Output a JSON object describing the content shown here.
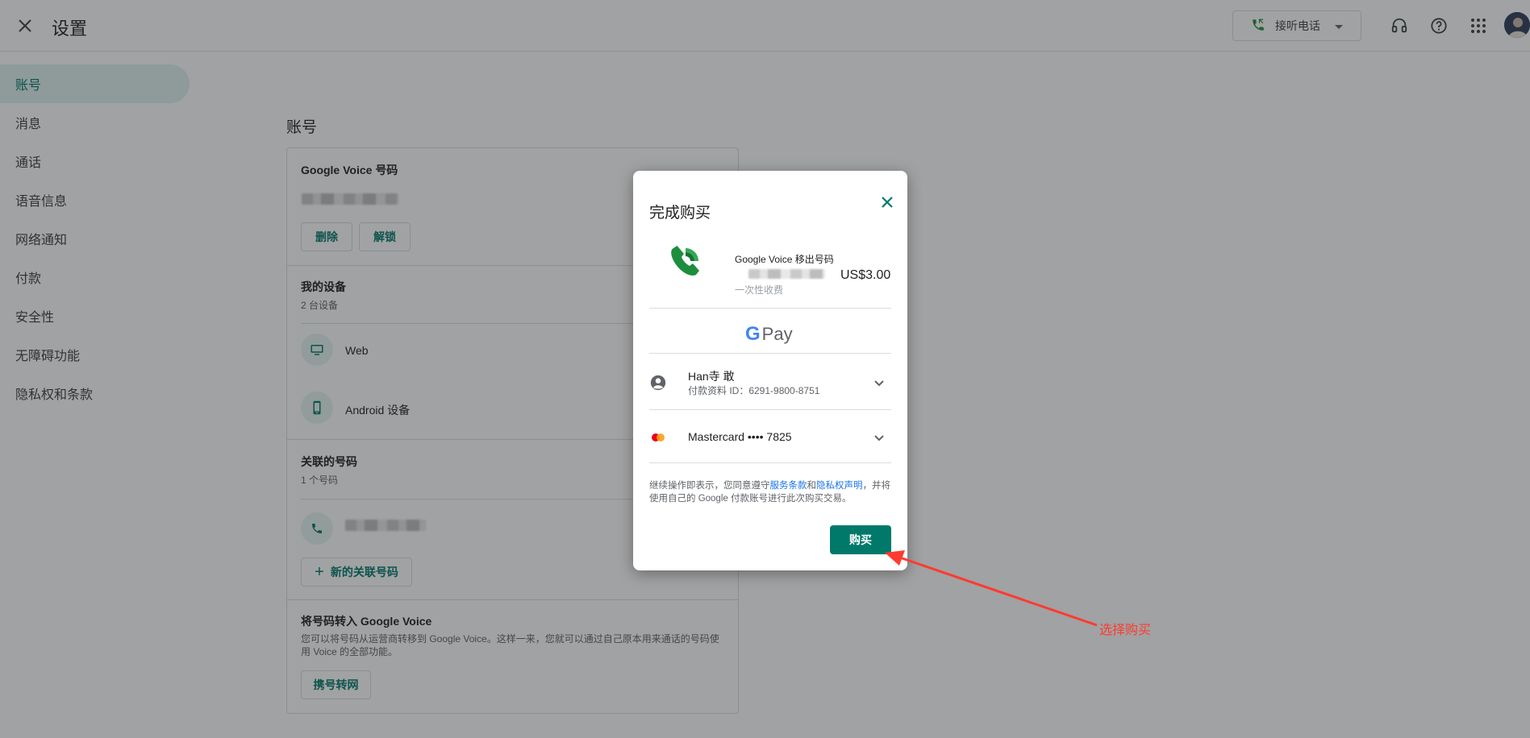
{
  "header": {
    "title": "设置",
    "answer_calls": "接听电话"
  },
  "sidebar": {
    "items": [
      {
        "label": "账号"
      },
      {
        "label": "消息"
      },
      {
        "label": "通话"
      },
      {
        "label": "语音信息"
      },
      {
        "label": "网络通知"
      },
      {
        "label": "付款"
      },
      {
        "label": "安全性"
      },
      {
        "label": "无障碍功能"
      },
      {
        "label": "隐私权和条款"
      }
    ]
  },
  "account": {
    "section_title": "账号",
    "gv_number": {
      "title": "Google Voice 号码",
      "delete_label": "删除",
      "unlock_label": "解锁"
    },
    "devices": {
      "title": "我的设备",
      "count": "2 台设备",
      "items": [
        {
          "label": "Web"
        },
        {
          "label": "Android 设备"
        }
      ]
    },
    "linked": {
      "title": "关联的号码",
      "count": "1 个号码",
      "add_label": "新的关联号码"
    },
    "port": {
      "title": "将号码转入 Google Voice",
      "description": "您可以将号码从运营商转移到 Google Voice。这样一来，您就可以通过自己原本用来通话的号码使用 Voice 的全部功能。",
      "button_label": "携号转网"
    }
  },
  "dialog": {
    "title": "完成购买",
    "product_name": "Google Voice 移出号码",
    "product_sub": "一次性收费",
    "price": "US$3.00",
    "gpay_g": "G",
    "gpay_label": "Pay",
    "profile_name": "Han寺 敢",
    "profile_id": "付款资料 ID：6291-9800-8751",
    "card": "Mastercard •••• 7825",
    "terms_pre": "继续操作即表示，您同意遵守",
    "terms_link1": "服务条款",
    "terms_and": "和",
    "terms_link2": "隐私权声明",
    "terms_post": "，并将使用自己的 Google 付款账号进行此次购买交易。",
    "buy_label": "购买"
  },
  "annotation": {
    "label": "选择购买",
    "color": "#ff3b30"
  },
  "colors": {
    "accent": "#00796b",
    "link": "#1a73e8"
  }
}
